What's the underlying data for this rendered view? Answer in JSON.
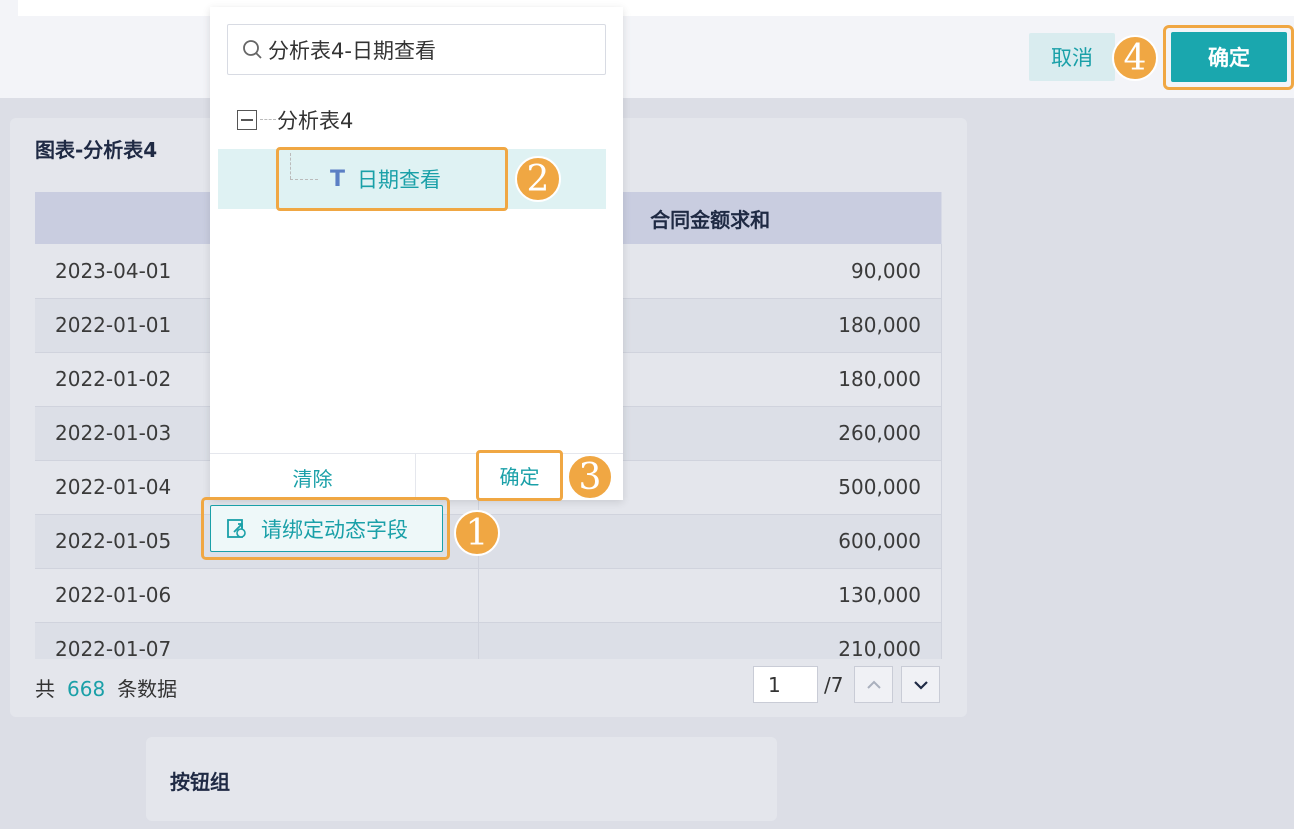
{
  "header": {
    "cancel_label": "取消",
    "confirm_label": "确定"
  },
  "badges": [
    "1",
    "2",
    "3",
    "4"
  ],
  "chart_card": {
    "title": "图表-分析表4",
    "columns": [
      "",
      "合同金额求和"
    ],
    "rows": [
      [
        "2023-04-01",
        "90,000"
      ],
      [
        "2022-01-01",
        "180,000"
      ],
      [
        "2022-01-02",
        "180,000"
      ],
      [
        "2022-01-03",
        "260,000"
      ],
      [
        "2022-01-04",
        "500,000"
      ],
      [
        "2022-01-05",
        "600,000"
      ],
      [
        "2022-01-06",
        "130,000"
      ],
      [
        "2022-01-07",
        "210,000"
      ]
    ],
    "footer": {
      "prefix": "共",
      "count": "668",
      "suffix": "条数据",
      "page": "1",
      "total": "/7"
    }
  },
  "button_group_card": {
    "title": "按钮组"
  },
  "dropdown": {
    "search_value": "分析表4-日期查看",
    "tree_root": "分析表4",
    "tree_child_icon": "T",
    "tree_child": "日期查看",
    "clear_label": "清除",
    "ok_label": "确定"
  },
  "bind_button": {
    "label": "请绑定动态字段"
  },
  "colors": {
    "accent": "#1aa7ae",
    "highlight": "#f0a743"
  }
}
